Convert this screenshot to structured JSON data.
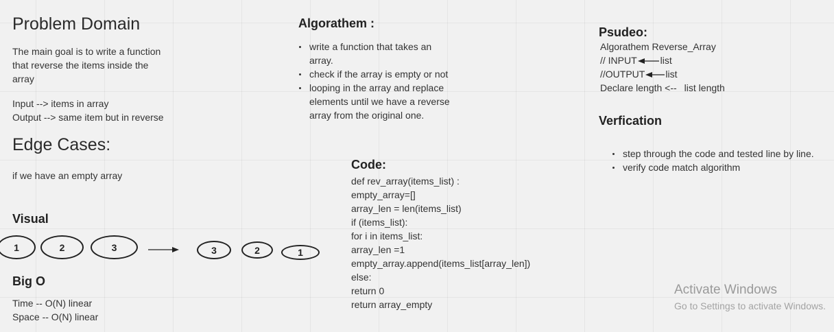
{
  "problem_domain": {
    "title": "Problem Domain",
    "goal_lines": [
      "The main goal is to write a function",
      "that reverse the items inside the",
      "array"
    ],
    "input_line": "Input --> items in array",
    "output_line": "Output --> same item but in reverse"
  },
  "edge_cases": {
    "title": "Edge Cases:",
    "text": "if we have an empty array"
  },
  "visual": {
    "title": "Visual",
    "before": [
      "1",
      "2",
      "3"
    ],
    "after": [
      "3",
      "2",
      "1"
    ]
  },
  "big_o": {
    "title": "Big O",
    "time": "Time -- O(N) linear",
    "space": "Space -- O(N) linear"
  },
  "algorithm": {
    "title": "Algorathem :",
    "items": [
      "write a function that takes an array.",
      "check if the array is empty or not",
      "looping in the array and replace elements until we have a reverse array from the original one."
    ]
  },
  "code": {
    "title": "Code:",
    "lines": [
      "def rev_array(items_list) :",
      "empty_array=[]",
      "array_len = len(items_list)",
      "if (items_list):",
      "for i in items_list:",
      "array_len =1",
      "empty_array.append(items_list[array_len])",
      "else:",
      "return 0",
      "return array_empty"
    ]
  },
  "pseudo": {
    "title": "Psudeo:",
    "line1": "Algorathem Reverse_Array",
    "input_label": "// INPUT",
    "input_value": "list",
    "output_label": "//OUTPUT",
    "output_value": "list",
    "declare_label": "Declare length <--",
    "declare_value": "list length"
  },
  "verification": {
    "title": "Verfication",
    "items": [
      "step through the code and tested line by line.",
      "verify code match algorithm"
    ]
  },
  "watermark": {
    "title": "Activate Windows",
    "subtitle": "Go to Settings to activate Windows."
  }
}
